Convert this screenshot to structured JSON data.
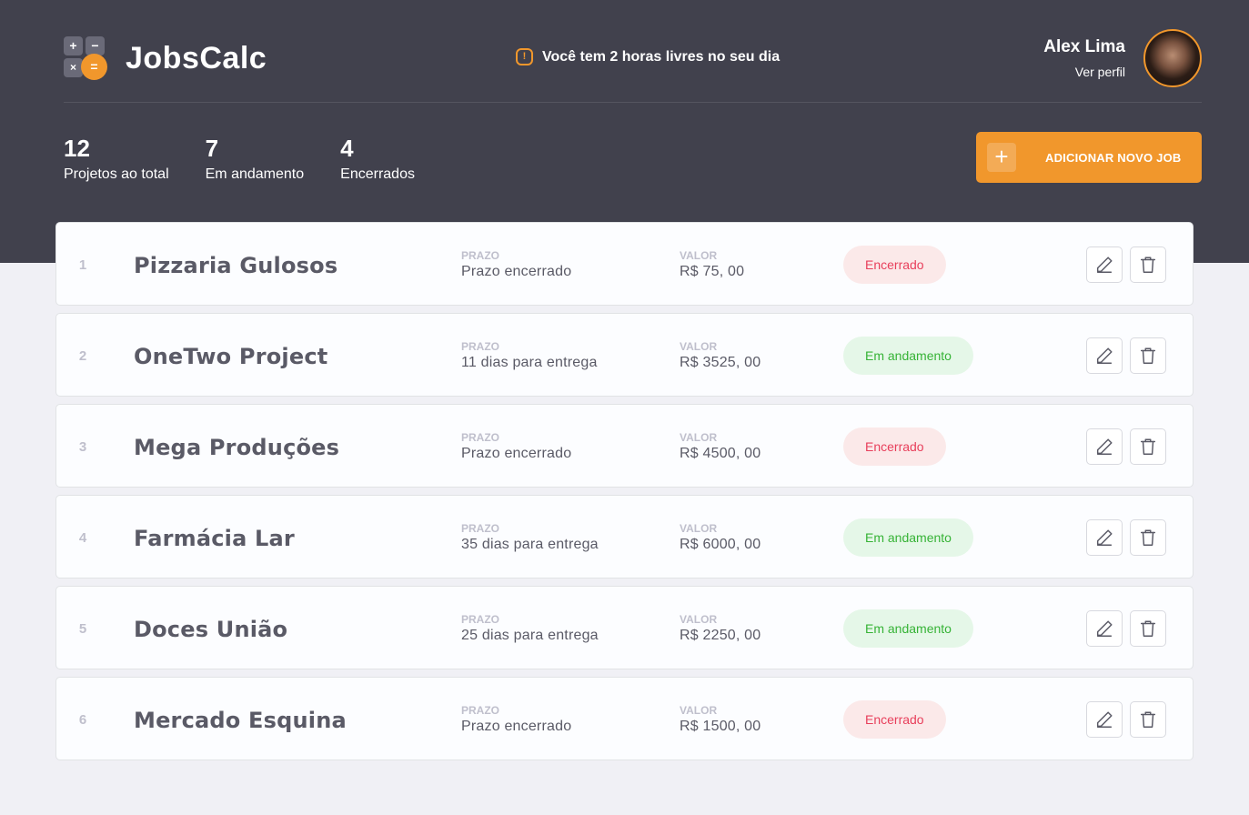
{
  "header": {
    "app_name": "JobsCalc",
    "logo_symbols": {
      "plus": "+",
      "minus": "−",
      "times": "×",
      "equals": "="
    },
    "notice_icon": "!",
    "notice": "Você tem 2 horas livres no seu dia",
    "user_name": "Alex Lima",
    "profile_link": "Ver perfil"
  },
  "summary": [
    {
      "value": "12",
      "label": "Projetos ao total"
    },
    {
      "value": "7",
      "label": "Em andamento"
    },
    {
      "value": "4",
      "label": "Encerrados"
    }
  ],
  "add_button": {
    "icon": "+",
    "label": "ADICIONAR NOVO JOB"
  },
  "field_labels": {
    "prazo": "PRAZO",
    "valor": "VALOR"
  },
  "jobs": [
    {
      "id": "1",
      "name": "Pizzaria Gulosos",
      "prazo": "Prazo encerrado",
      "valor": "R$ 75, 00",
      "status": "Encerrado",
      "status_type": "closed"
    },
    {
      "id": "2",
      "name": "OneTwo Project",
      "prazo": "11 dias para entrega",
      "valor": "R$ 3525, 00",
      "status": "Em andamento",
      "status_type": "progress"
    },
    {
      "id": "3",
      "name": "Mega Produções",
      "prazo": "Prazo encerrado",
      "valor": "R$ 4500, 00",
      "status": "Encerrado",
      "status_type": "closed"
    },
    {
      "id": "4",
      "name": "Farmácia Lar",
      "prazo": "35 dias para entrega",
      "valor": "R$ 6000, 00",
      "status": "Em andamento",
      "status_type": "progress"
    },
    {
      "id": "5",
      "name": "Doces União",
      "prazo": "25 dias para entrega",
      "valor": "R$ 2250, 00",
      "status": "Em andamento",
      "status_type": "progress"
    },
    {
      "id": "6",
      "name": "Mercado Esquina",
      "prazo": "Prazo encerrado",
      "valor": "R$ 1500, 00",
      "status": "Encerrado",
      "status_type": "closed"
    }
  ],
  "icons": {
    "edit": "pencil-icon",
    "delete": "trash-icon",
    "warning": "warning-icon"
  },
  "colors": {
    "header_bg": "#41414d",
    "accent": "#f1972c",
    "page_bg": "#f0f0f5",
    "closed_bg": "#fbe9e9",
    "closed_text": "#e83f5b",
    "progress_bg": "#e5f7e8",
    "progress_text": "#36b336"
  }
}
